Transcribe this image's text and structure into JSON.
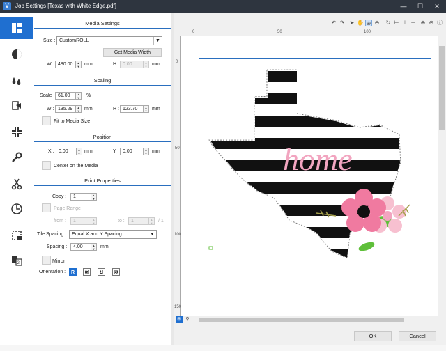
{
  "window": {
    "title": "Job Settings [Texas with White Edge.pdf]",
    "app_icon": "V",
    "minimize": "—",
    "restore": "☐",
    "close": "✕"
  },
  "sidebar": {
    "items": [
      {
        "name": "layout-icon",
        "active": true
      },
      {
        "name": "color-icon"
      },
      {
        "name": "ink-drops-icon"
      },
      {
        "name": "print-mode-icon"
      },
      {
        "name": "crop-marks-icon"
      },
      {
        "name": "wrench-icon"
      },
      {
        "name": "scissors-icon"
      },
      {
        "name": "clock-icon"
      },
      {
        "name": "select-area-icon"
      },
      {
        "name": "copies-icon"
      }
    ]
  },
  "media": {
    "header": "Media Settings",
    "size_label": "Size :",
    "size_value": "CustomROLL",
    "get_width_button": "Get Media Width",
    "w_label": "W :",
    "w_value": "480.00",
    "h_label": "H :",
    "h_value": "0.00",
    "unit": "mm"
  },
  "scaling": {
    "header": "Scaling",
    "scale_label": "Scale :",
    "scale_value": "61.00",
    "percent": "%",
    "w_label": "W :",
    "w_value": "135.29",
    "h_label": "H :",
    "h_value": "123.70",
    "unit": "mm",
    "fit_label": "Fit to Media Size"
  },
  "position": {
    "header": "Position",
    "x_label": "X :",
    "x_value": "0.00",
    "y_label": "Y :",
    "y_value": "0.00",
    "unit": "mm",
    "center_label": "Center on the Media"
  },
  "print": {
    "header": "Print Properties",
    "copy_label": "Copy :",
    "copy_value": "1",
    "page_range_label": "Page Range",
    "from_label": "from :",
    "from_value": "1",
    "to_label": "to :",
    "to_value": "1",
    "of_label": "/ 1",
    "tile_label": "Tile Spacing :",
    "tile_value": "Equal X and Y Spacing",
    "spacing_label": "Spacing :",
    "spacing_value": "4.00",
    "unit": "mm",
    "mirror_label": "Mirror",
    "orientation_label": "Orientation :",
    "orientations": [
      "R",
      "R",
      "R",
      "R"
    ]
  },
  "preview": {
    "ruler_top": [
      "0",
      "50",
      "100"
    ],
    "ruler_left": [
      "0",
      "50",
      "100",
      "150"
    ],
    "artwork_text": "home",
    "colors": {
      "pink": "#f2a5c0",
      "green": "#5fbf3a",
      "black": "#111111",
      "olive": "#a5a04c",
      "accent": "#1f6fd0"
    }
  },
  "buttons": {
    "ok": "OK",
    "cancel": "Cancel"
  }
}
